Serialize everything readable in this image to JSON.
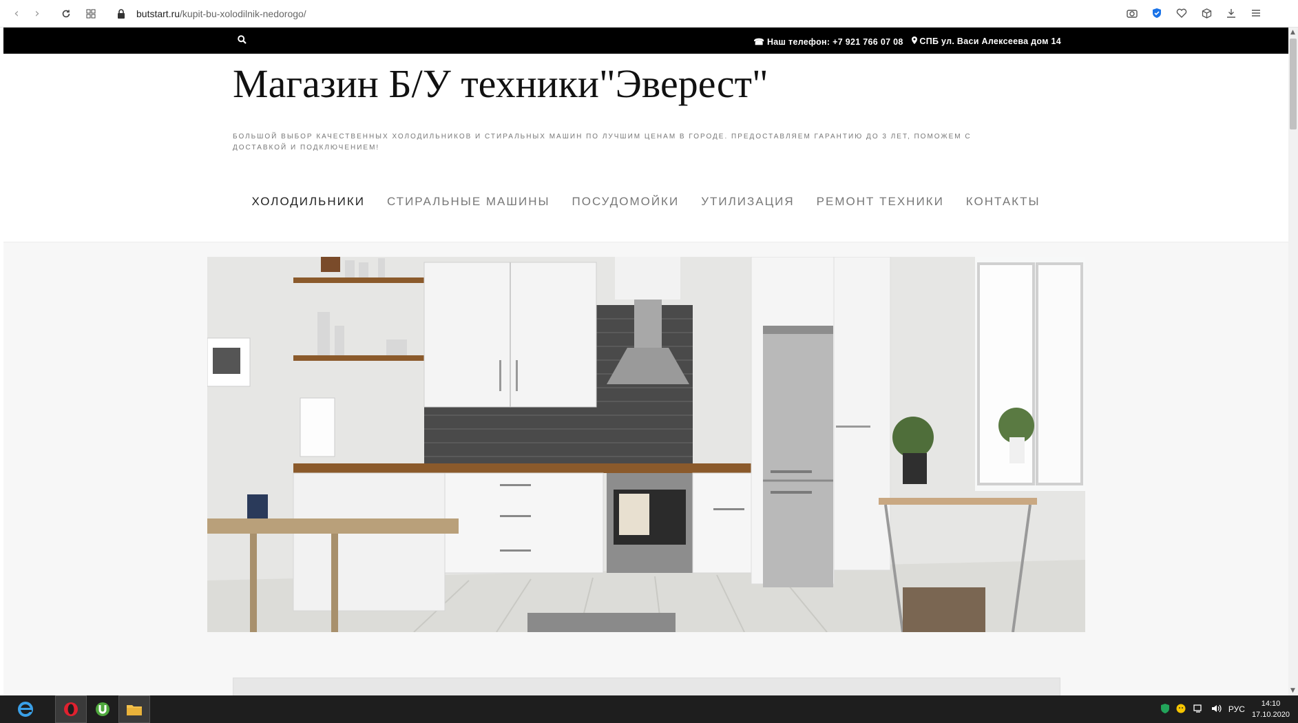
{
  "browser": {
    "url_host": "butstart.ru",
    "url_path": "/kupit-bu-xolodilnik-nedorogo/"
  },
  "topbar": {
    "phone": "Наш телефон: +7 921 766 07 08",
    "address": "СПБ ул. Васи Алексеева дом 14"
  },
  "header": {
    "title": "Магазин Б/У техники\"Эверест\"",
    "tagline": "Большой выбор качественных холодильников и стиральных машин по лучшим ценам в городе. Предоставляем гарантию до 3 лет, поможем с доставкой и подключением!"
  },
  "menu": {
    "items": [
      {
        "label": "Холодильники",
        "active": true
      },
      {
        "label": "Стиральные машины",
        "active": false
      },
      {
        "label": "Посудомойки",
        "active": false
      },
      {
        "label": "Утилизация",
        "active": false
      },
      {
        "label": "Ремонт техники",
        "active": false
      },
      {
        "label": "Контакты",
        "active": false
      }
    ]
  },
  "taskbar": {
    "language": "РУС",
    "time": "14:10",
    "date": "17.10.2020"
  }
}
